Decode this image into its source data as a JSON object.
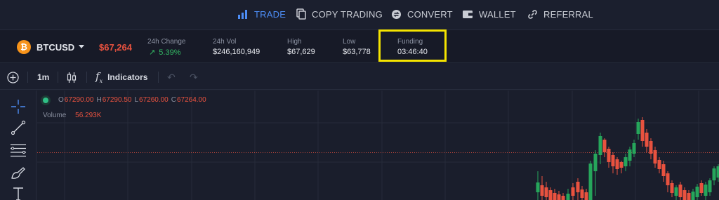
{
  "nav": {
    "items": [
      {
        "label": "TRADE",
        "icon": "bar-chart-icon",
        "active": true
      },
      {
        "label": "COPY TRADING",
        "icon": "copy-icon"
      },
      {
        "label": "CONVERT",
        "icon": "convert-icon"
      },
      {
        "label": "WALLET",
        "icon": "wallet-icon"
      },
      {
        "label": "REFERRAL",
        "icon": "link-icon"
      }
    ]
  },
  "ticker": {
    "coin_logo_letter": "₿",
    "symbol": "BTCUSD",
    "price": "$67,264",
    "change_label": "24h Change",
    "change_value": "5.39%",
    "vol_label": "24h Vol",
    "vol_value": "$246,160,949",
    "high_label": "High",
    "high_value": "$67,629",
    "low_label": "Low",
    "low_value": "$63,778",
    "funding_label": "Funding",
    "funding_value": "03:46:40"
  },
  "toolbar": {
    "interval": "1m",
    "indicators_label": "Indicators"
  },
  "chart": {
    "ohlc": {
      "o_key": "O",
      "o_val": "67290.00",
      "h_key": "H",
      "h_val": "67290.50",
      "l_key": "L",
      "l_val": "67260.00",
      "c_key": "C",
      "c_val": "67264.00"
    },
    "volume_label": "Volume",
    "volume_value": "56.293K"
  },
  "colors": {
    "up": "#26a65b",
    "down": "#e8523f",
    "accent": "#4d8df6",
    "highlight": "#f5e400"
  }
}
